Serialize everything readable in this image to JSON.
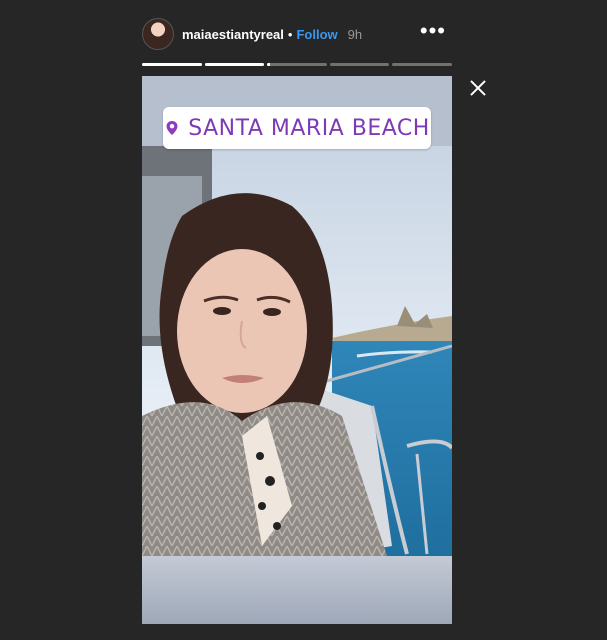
{
  "header": {
    "username": "maiaestiantyreal",
    "separator": "•",
    "follow_label": "Follow",
    "time": "9h",
    "more_label": "•••"
  },
  "progress": {
    "segments": [
      1,
      1,
      0.05,
      0,
      0
    ]
  },
  "story": {
    "location_sticker": "SANTA MARIA BEACH"
  },
  "icons": {
    "close": "close-icon",
    "location": "location-pin-icon",
    "more": "more-options-icon"
  },
  "colors": {
    "follow": "#3897f0",
    "sticker_text": "#7e3ab4",
    "background": "#262626"
  }
}
